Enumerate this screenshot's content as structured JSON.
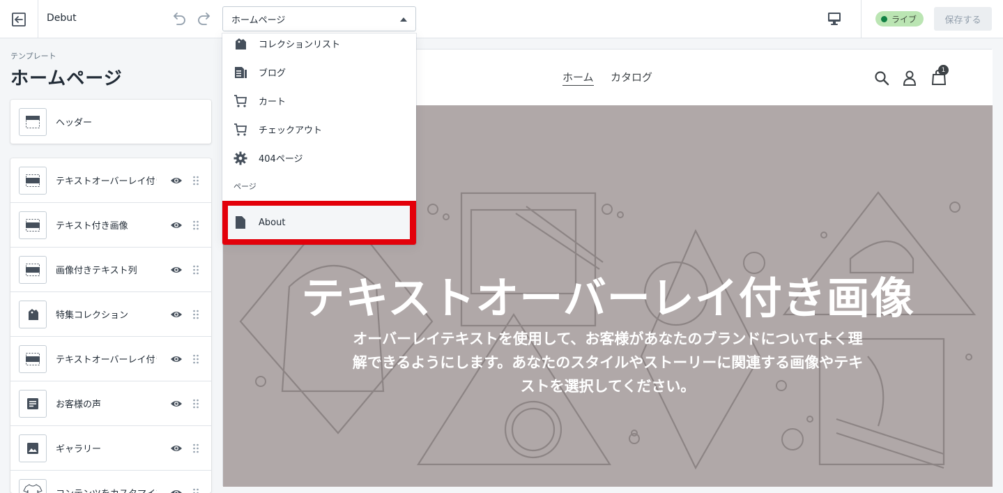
{
  "topbar": {
    "theme_name": "Debut",
    "template_select": "ホームページ",
    "live_badge": "ライブ",
    "save_label": "保存する"
  },
  "sidebar": {
    "section_label": "テンプレート",
    "title": "ホームページ",
    "header_item": "ヘッダー",
    "items": [
      {
        "label": "テキストオーバーレイ付き画像",
        "icon": "section-icon"
      },
      {
        "label": "テキスト付き画像",
        "icon": "section-icon"
      },
      {
        "label": "画像付きテキスト列",
        "icon": "section-icon"
      },
      {
        "label": "特集コレクション",
        "icon": "collection-icon"
      },
      {
        "label": "テキストオーバーレイ付き画像",
        "icon": "section-icon"
      },
      {
        "label": "お客様の声",
        "icon": "document-icon"
      },
      {
        "label": "ギャラリー",
        "icon": "image-icon"
      },
      {
        "label": "コンテンツをカスタマイズ",
        "icon": "shirt-icon"
      }
    ]
  },
  "dropdown": {
    "items": [
      {
        "label": "コレクションリスト",
        "icon": "collection-icon"
      },
      {
        "label": "ブログ",
        "icon": "blog-icon"
      },
      {
        "label": "カート",
        "icon": "cart-icon"
      },
      {
        "label": "チェックアウト",
        "icon": "cart-icon"
      },
      {
        "label": "404ページ",
        "icon": "gear-icon"
      }
    ],
    "section_label": "ページ",
    "highlighted_item": "About",
    "highlight_color": "#e3000a"
  },
  "preview": {
    "nav_home": "ホーム",
    "nav_catalog": "カタログ",
    "cart_count": "1",
    "hero_title": "テキストオーバーレイ付き画像",
    "hero_text": "オーバーレイテキストを使用して、お客様があなたのブランドについてよく理解できるようにします。あなたのスタイルやストーリーに関連する画像やテキストを選択してください。"
  }
}
